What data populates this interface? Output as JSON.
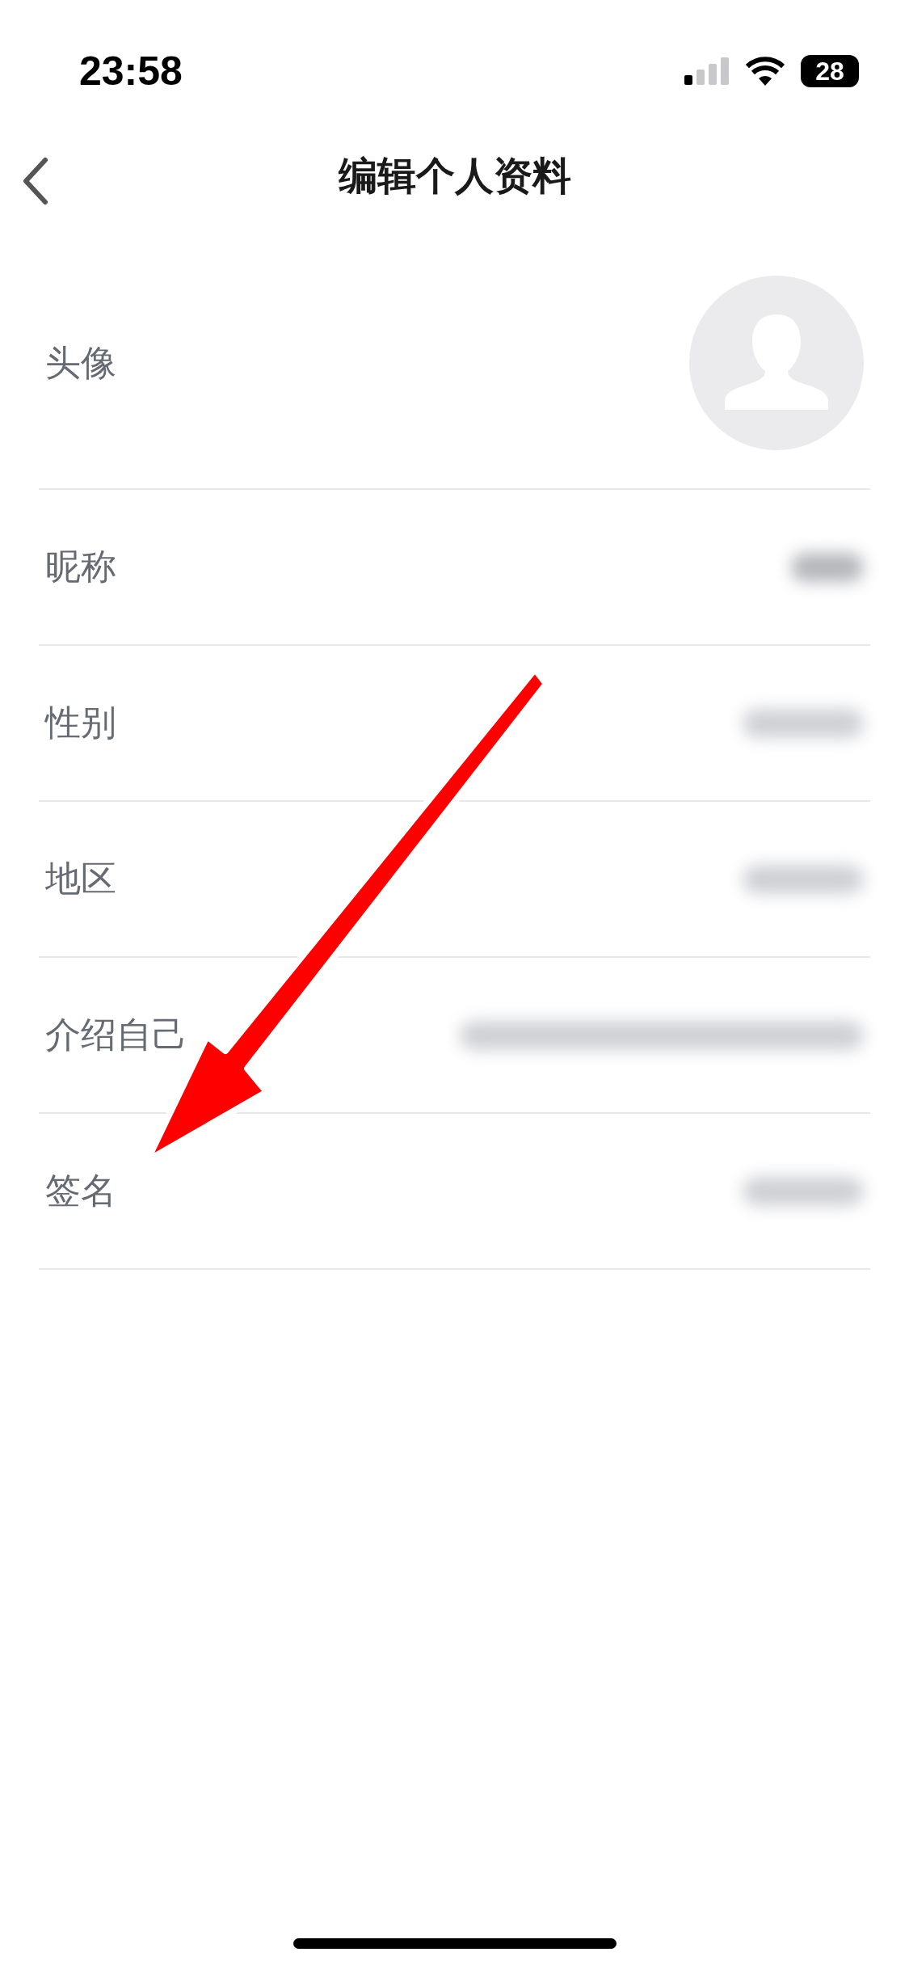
{
  "status_bar": {
    "time": "23:58",
    "battery": "28"
  },
  "nav": {
    "title": "编辑个人资料"
  },
  "rows": [
    {
      "kind": "avatar",
      "label": "头像"
    },
    {
      "kind": "short_value",
      "label": "昵称"
    },
    {
      "kind": "value",
      "label": "性别"
    },
    {
      "kind": "value",
      "label": "地区"
    },
    {
      "kind": "long_value",
      "label": "介绍自己"
    },
    {
      "kind": "value",
      "label": "签名"
    }
  ],
  "annotation": {
    "kind": "arrow"
  }
}
